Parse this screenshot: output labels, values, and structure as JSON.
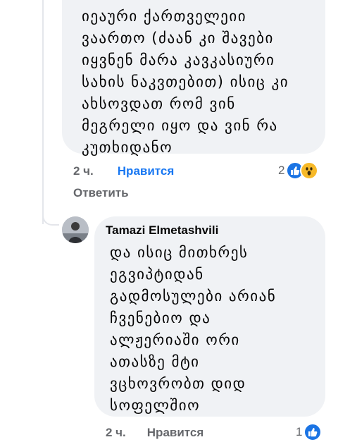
{
  "thread": {
    "first_comment": {
      "text": "იეაური ქართველეიი\nვაართო (ძაან კი შავები\nიყვნენ მარა კავკასიური\nსახის ნაკვთებით) ისიც კი\nახსოვდათ რომ ვინ\nმეგრელი იყო და ვინ რა\nკუთხიდანო",
      "time": "2 ч.",
      "like_label": "Нравится",
      "reaction_count": "2",
      "reactions": [
        "like-icon",
        "wow-icon"
      ],
      "reply_label": "Ответить"
    },
    "reply_comment": {
      "author": "Tamazi Elmetashvili",
      "text": "და ისიც მითხრეს\nეგვიპტიდან\nგადმოსულები არიან\nჩვენებიო და\nალჟერიაში ორი\nათასზე მტი\nვცხოვრობთ დიდ\nსოფელშიო",
      "time": "2 ч.",
      "like_label": "Нравится",
      "reaction_count": "1",
      "reactions": [
        "like-icon"
      ]
    }
  },
  "colors": {
    "bubble": "#f0f2f5",
    "link_active": "#1877f2",
    "secondary_text": "#65676b",
    "like_icon": "#1b74e4",
    "wow_icon": "#f7b928"
  }
}
